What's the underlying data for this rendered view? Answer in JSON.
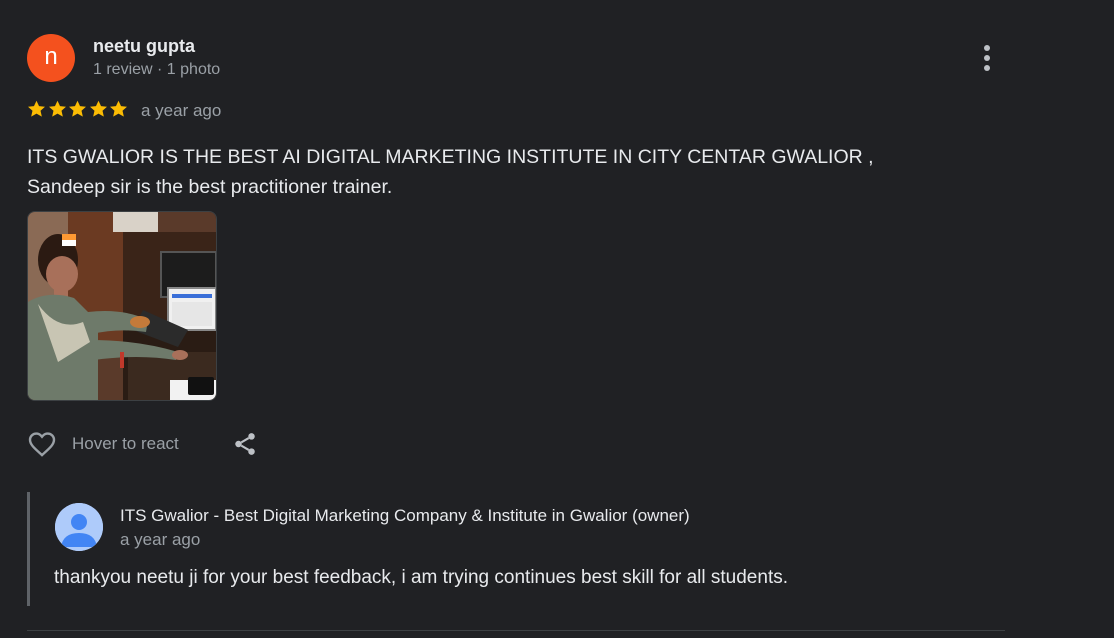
{
  "review": {
    "avatar_letter": "n",
    "avatar_color": "#f4511e",
    "reviewer_name": "neetu gupta",
    "reviewer_meta": "1 review · 1 photo",
    "rating": 5,
    "rating_max": 5,
    "star_color": "#fbbc04",
    "date": "a year ago",
    "text_line1": "ITS GWALIOR IS THE BEST AI DIGITAL MARKETING INSTITUTE IN CITY CENTAR GWALIOR ,",
    "text_line2": "Sandeep sir is the best practitioner trainer.",
    "more_icon": "more-vert-icon",
    "photo_icon": "review-photo"
  },
  "actions": {
    "heart_icon": "heart-outline-icon",
    "react_label": "Hover to react",
    "share_icon": "share-icon"
  },
  "owner_reply": {
    "avatar_icon": "account-circle-icon",
    "name": "ITS Gwalior - Best Digital Marketing Company & Institute in Gwalior (owner)",
    "date": "a year ago",
    "text": "thankyou neetu ji for your best feedback, i am trying continues best skill for all students."
  }
}
